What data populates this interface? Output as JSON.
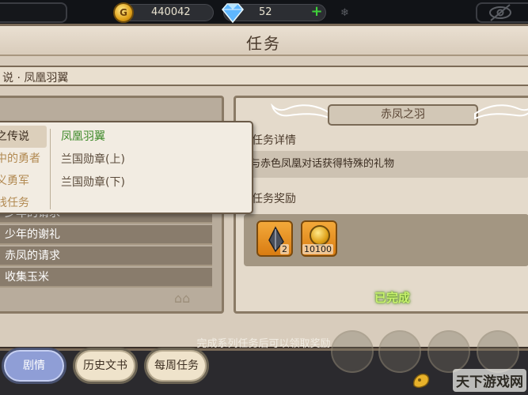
{
  "resources": {
    "gold": "440042",
    "gems": "52"
  },
  "window": {
    "title": "任务",
    "breadcrumb": "说 · 凤凰羽翼"
  },
  "dropdown": {
    "left_items": [
      "之传说",
      "中的勇者",
      "义勇军",
      "线任务"
    ],
    "right_items": [
      "凤凰羽翼",
      "兰国勋章(上)",
      "兰国勋章(下)"
    ]
  },
  "quest_list": [
    "少年的请求",
    "少年的谢礼",
    "赤凤的请求",
    "收集玉米"
  ],
  "quest_detail": {
    "name": "赤凤之羽",
    "detail_heading": "任务详情",
    "description": "与赤色凤凰对话获得特殊的礼物",
    "reward_heading": "任务奖励",
    "rewards": [
      {
        "icon": "feather-icon",
        "count": "2"
      },
      {
        "icon": "coin-icon",
        "count": "10100"
      }
    ],
    "status": "已完成"
  },
  "footer_note": "完成系列任务后可以领取奖励",
  "tabs": [
    "剧情",
    "历史文书",
    "每周任务"
  ],
  "watermark": "天下游戏网",
  "colors": {
    "panel_bg": "#d8ccbc",
    "active_tab": "#8f9ed6",
    "reward_orange": "#e8921f",
    "completed_green": "#c8f16e"
  }
}
